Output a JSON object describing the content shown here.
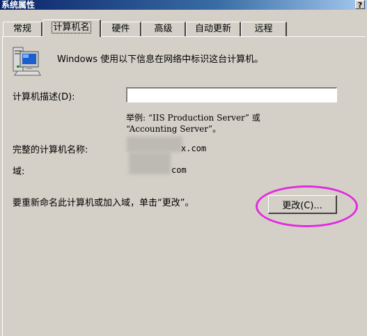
{
  "window": {
    "title": "系统属性",
    "help_label": "?"
  },
  "tabs": [
    {
      "label": "常规",
      "active": false
    },
    {
      "label": "计算机名",
      "active": true
    },
    {
      "label": "硬件",
      "active": false
    },
    {
      "label": "高级",
      "active": false
    },
    {
      "label": "自动更新",
      "active": false
    },
    {
      "label": "远程",
      "active": false
    }
  ],
  "content": {
    "icon": "computer-icon",
    "intro": "Windows 使用以下信息在网络中标识这台计算机。",
    "description_label": "计算机描述(D):",
    "description_value": "",
    "example_line1": "举例: “IIS Production Server” 或",
    "example_line2": "“Accounting Server”。",
    "full_name_label": "完整的计算机名称:",
    "full_name_value": "x.com",
    "domain_label": "域:",
    "domain_value": "com",
    "rename_text": "要重新命名此计算机或加入域，单击“更改”。",
    "change_button": "更改(C)..."
  },
  "colors": {
    "window_bg": "#d4d0c8",
    "annotation_circle": "#e02be0"
  }
}
